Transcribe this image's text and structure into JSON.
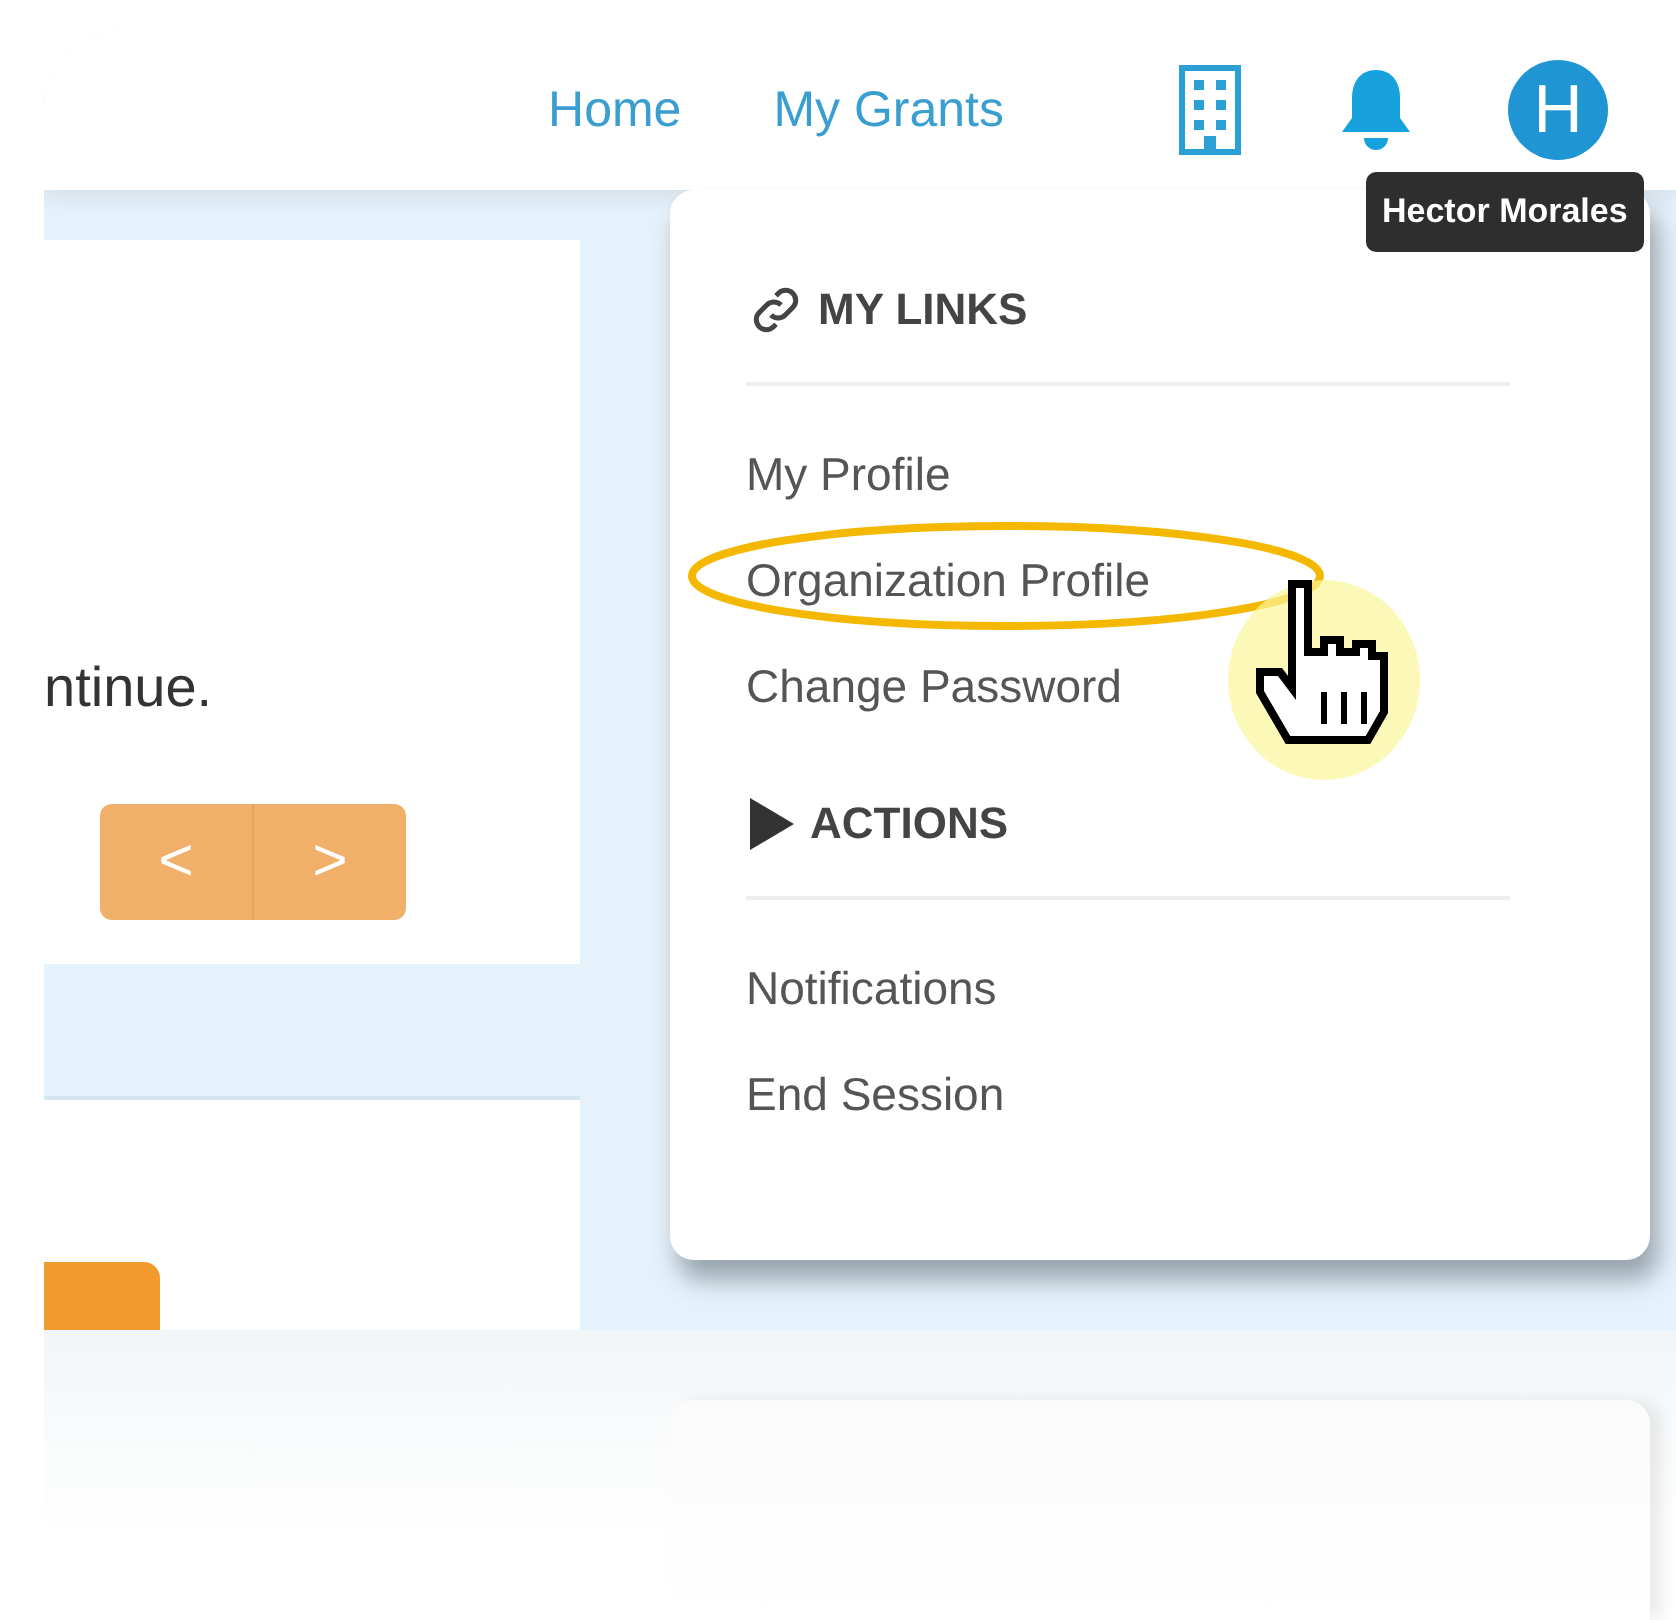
{
  "nav": {
    "links": [
      "Home",
      "My Grants"
    ],
    "avatar_initial": "H",
    "tooltip": "Hector Morales"
  },
  "content": {
    "text": "ntinue.",
    "pager": [
      "<",
      ">"
    ]
  },
  "menu": {
    "sections": [
      {
        "kind": "links",
        "title": "MY LINKS",
        "items": [
          {
            "label": "My Profile",
            "highlighted": false
          },
          {
            "label": "Organization Profile",
            "highlighted": true
          },
          {
            "label": "Change Password",
            "highlighted": false
          }
        ]
      },
      {
        "kind": "actions",
        "title": "ACTIONS",
        "items": [
          {
            "label": "Notifications",
            "highlighted": false
          },
          {
            "label": "End Session",
            "highlighted": false
          }
        ]
      }
    ]
  }
}
